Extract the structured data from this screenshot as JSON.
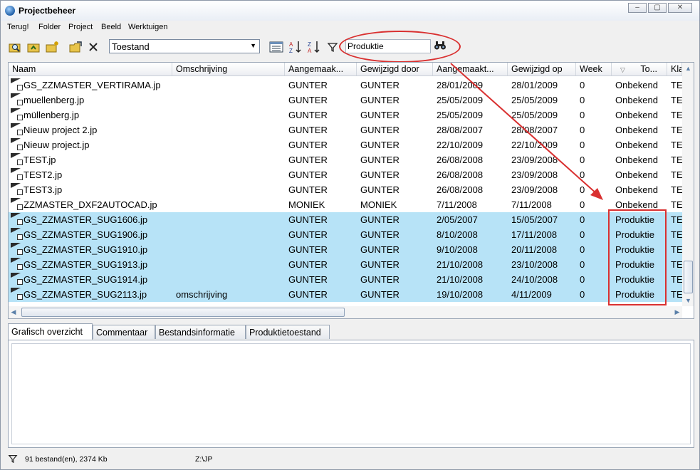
{
  "window": {
    "title": "Projectbeheer"
  },
  "menu": [
    "Terug!",
    "Folder",
    "Project",
    "Beeld",
    "Werktuigen"
  ],
  "toolbar": {
    "toestand_value": "Toestand",
    "search_value": "Produktie"
  },
  "grid": {
    "columns": [
      "Naam",
      "Omschrijving",
      "Aangemaak...",
      "Gewijzigd door",
      "Aangemaakt...",
      "Gewijzigd op",
      "Week",
      "To...",
      "Kla"
    ],
    "rows": [
      {
        "naam": "GS_ZZMASTER_VERTIRAMA.jp",
        "omschrijving": "",
        "aangemaakt_door": "GUNTER",
        "gewijzigd_door": "GUNTER",
        "aangemaakt_op": "28/01/2009",
        "gewijzigd_op": "28/01/2009",
        "week": "0",
        "toestand": "Onbekend",
        "klasse": "TE",
        "selected": false
      },
      {
        "naam": "muellenberg.jp",
        "omschrijving": "",
        "aangemaakt_door": "GUNTER",
        "gewijzigd_door": "GUNTER",
        "aangemaakt_op": "25/05/2009",
        "gewijzigd_op": "25/05/2009",
        "week": "0",
        "toestand": "Onbekend",
        "klasse": "TE",
        "selected": false
      },
      {
        "naam": "müllenberg.jp",
        "omschrijving": "",
        "aangemaakt_door": "GUNTER",
        "gewijzigd_door": "GUNTER",
        "aangemaakt_op": "25/05/2009",
        "gewijzigd_op": "25/05/2009",
        "week": "0",
        "toestand": "Onbekend",
        "klasse": "TE",
        "selected": false
      },
      {
        "naam": "Nieuw project 2.jp",
        "omschrijving": "",
        "aangemaakt_door": "GUNTER",
        "gewijzigd_door": "GUNTER",
        "aangemaakt_op": "28/08/2007",
        "gewijzigd_op": "28/08/2007",
        "week": "0",
        "toestand": "Onbekend",
        "klasse": "TE",
        "selected": false
      },
      {
        "naam": "Nieuw project.jp",
        "omschrijving": "",
        "aangemaakt_door": "GUNTER",
        "gewijzigd_door": "GUNTER",
        "aangemaakt_op": "22/10/2009",
        "gewijzigd_op": "22/10/2009",
        "week": "0",
        "toestand": "Onbekend",
        "klasse": "TE",
        "selected": false
      },
      {
        "naam": "TEST.jp",
        "omschrijving": "",
        "aangemaakt_door": "GUNTER",
        "gewijzigd_door": "GUNTER",
        "aangemaakt_op": "26/08/2008",
        "gewijzigd_op": "23/09/2008",
        "week": "0",
        "toestand": "Onbekend",
        "klasse": "TE",
        "selected": false
      },
      {
        "naam": "TEST2.jp",
        "omschrijving": "",
        "aangemaakt_door": "GUNTER",
        "gewijzigd_door": "GUNTER",
        "aangemaakt_op": "26/08/2008",
        "gewijzigd_op": "23/09/2008",
        "week": "0",
        "toestand": "Onbekend",
        "klasse": "TE",
        "selected": false
      },
      {
        "naam": "TEST3.jp",
        "omschrijving": "",
        "aangemaakt_door": "GUNTER",
        "gewijzigd_door": "GUNTER",
        "aangemaakt_op": "26/08/2008",
        "gewijzigd_op": "23/09/2008",
        "week": "0",
        "toestand": "Onbekend",
        "klasse": "TE",
        "selected": false
      },
      {
        "naam": "ZZMASTER_DXF2AUTOCAD.jp",
        "omschrijving": "",
        "aangemaakt_door": "MONIEK",
        "gewijzigd_door": "MONIEK",
        "aangemaakt_op": "7/11/2008",
        "gewijzigd_op": "7/11/2008",
        "week": "0",
        "toestand": "Onbekend",
        "klasse": "TE",
        "selected": false
      },
      {
        "naam": "GS_ZZMASTER_SUG1606.jp",
        "omschrijving": "",
        "aangemaakt_door": "GUNTER",
        "gewijzigd_door": "GUNTER",
        "aangemaakt_op": "2/05/2007",
        "gewijzigd_op": "15/05/2007",
        "week": "0",
        "toestand": "Produktie",
        "klasse": "TE",
        "selected": true
      },
      {
        "naam": "GS_ZZMASTER_SUG1906.jp",
        "omschrijving": "",
        "aangemaakt_door": "GUNTER",
        "gewijzigd_door": "GUNTER",
        "aangemaakt_op": "8/10/2008",
        "gewijzigd_op": "17/11/2008",
        "week": "0",
        "toestand": "Produktie",
        "klasse": "TE",
        "selected": true
      },
      {
        "naam": "GS_ZZMASTER_SUG1910.jp",
        "omschrijving": "",
        "aangemaakt_door": "GUNTER",
        "gewijzigd_door": "GUNTER",
        "aangemaakt_op": "9/10/2008",
        "gewijzigd_op": "20/11/2008",
        "week": "0",
        "toestand": "Produktie",
        "klasse": "TE",
        "selected": true
      },
      {
        "naam": "GS_ZZMASTER_SUG1913.jp",
        "omschrijving": "",
        "aangemaakt_door": "GUNTER",
        "gewijzigd_door": "GUNTER",
        "aangemaakt_op": "21/10/2008",
        "gewijzigd_op": "23/10/2008",
        "week": "0",
        "toestand": "Produktie",
        "klasse": "TE",
        "selected": true
      },
      {
        "naam": "GS_ZZMASTER_SUG1914.jp",
        "omschrijving": "",
        "aangemaakt_door": "GUNTER",
        "gewijzigd_door": "GUNTER",
        "aangemaakt_op": "21/10/2008",
        "gewijzigd_op": "24/10/2008",
        "week": "0",
        "toestand": "Produktie",
        "klasse": "TE",
        "selected": true
      },
      {
        "naam": "GS_ZZMASTER_SUG2113.jp",
        "omschrijving": "omschrijving",
        "aangemaakt_door": "GUNTER",
        "gewijzigd_door": "GUNTER",
        "aangemaakt_op": "19/10/2008",
        "gewijzigd_op": "4/11/2009",
        "week": "0",
        "toestand": "Produktie",
        "klasse": "TE",
        "selected": true
      }
    ]
  },
  "tabs": [
    "Grafisch overzicht",
    "Commentaar",
    "Bestandsinformatie",
    "Produktietoestand"
  ],
  "status": {
    "files": "91 bestand(en), 2374 Kb",
    "path": "Z:\\JP"
  },
  "colors": {
    "selection": "#b7e3f7",
    "annotation": "#d93030"
  }
}
